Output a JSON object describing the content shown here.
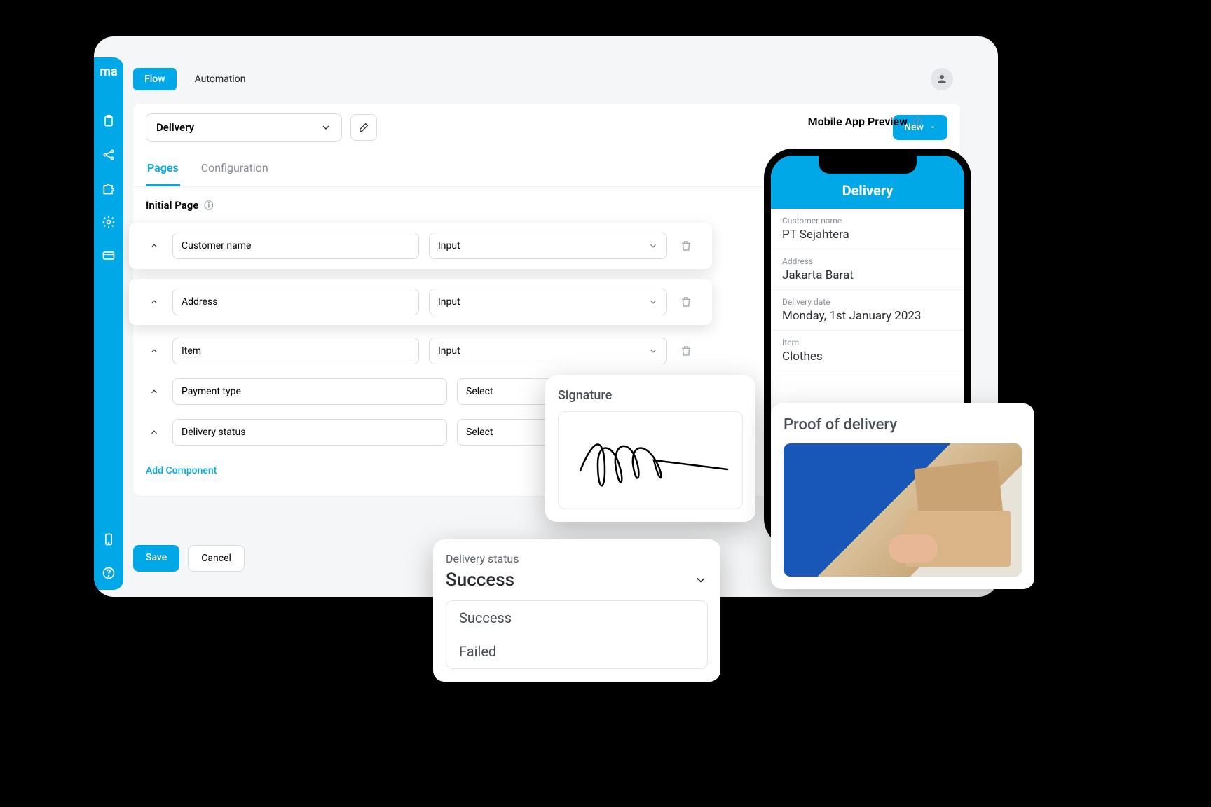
{
  "brand": "ma",
  "topbar": {
    "flow": "Flow",
    "automation": "Automation"
  },
  "content": {
    "page_select": "Delivery",
    "new_button": "New",
    "subtabs": {
      "pages": "Pages",
      "configuration": "Configuration"
    },
    "section_title": "Initial Page",
    "fields": [
      {
        "name": "Customer name",
        "type": "Input"
      },
      {
        "name": "Address",
        "type": "Input"
      },
      {
        "name": "Item",
        "type": "Input"
      },
      {
        "name": "Payment type",
        "type": "Select"
      },
      {
        "name": "Delivery status",
        "type": "Select"
      }
    ],
    "add_component": "Add Component",
    "save": "Save",
    "cancel": "Cancel"
  },
  "preview": {
    "title": "Mobile App Preview",
    "phone_title": "Delivery",
    "fields": [
      {
        "label": "Customer name",
        "value": "PT Sejahtera"
      },
      {
        "label": "Address",
        "value": "Jakarta Barat"
      },
      {
        "label": "Delivery date",
        "value": "Monday, 1st January 2023"
      },
      {
        "label": "Item",
        "value": "Clothes"
      }
    ]
  },
  "popups": {
    "signature": {
      "title": "Signature"
    },
    "status": {
      "label": "Delivery status",
      "selected": "Success",
      "options": [
        "Success",
        "Failed"
      ]
    },
    "proof": {
      "title": "Proof of delivery"
    }
  },
  "colors": {
    "accent": "#00a8e8"
  }
}
